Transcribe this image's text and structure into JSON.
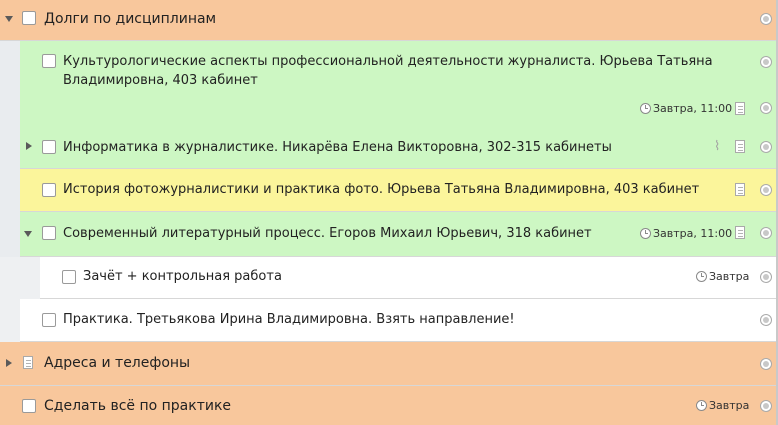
{
  "items": [
    {
      "label": "Долги по дисциплинам"
    },
    {
      "label_line1": "Культурологические аспекты профессиональной деятельности журналиста. Юрьева Татьяна",
      "label_line2": "Владимировна, 403 кабинет",
      "due": "Завтра, 11:00"
    },
    {
      "label": "Информатика в журналистике. Никарёва Елена Викторовна, 302-315 кабинеты"
    },
    {
      "label": "История фотожурналистики и практика фото. Юрьева Татьяна Владимировна, 403 кабинет"
    },
    {
      "label": "Современный литературный процесс. Егоров Михаил Юрьевич, 318 кабинет",
      "due": "Завтра, 11:00"
    },
    {
      "label": "Зачёт + контрольная работа",
      "due": "Завтра"
    },
    {
      "label": "Практика. Третьякова Ирина Владимировна. Взять направление!"
    },
    {
      "label": "Адреса и телефоны"
    },
    {
      "label": "Сделать всё по практике",
      "due": "Завтра"
    }
  ]
}
